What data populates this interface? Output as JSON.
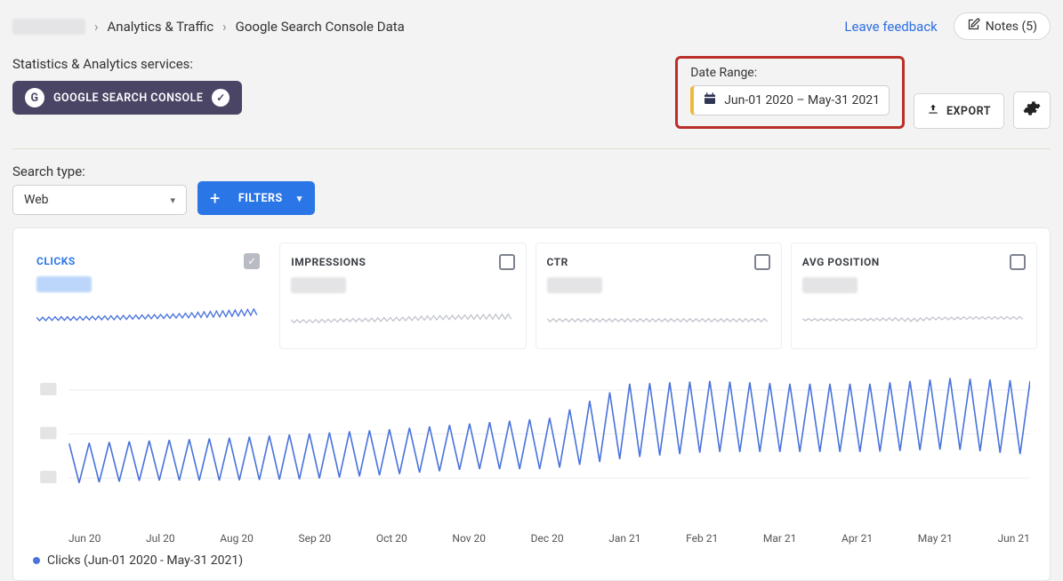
{
  "breadcrumb": {
    "section": "Analytics & Traffic",
    "page": "Google Search Console Data"
  },
  "header": {
    "feedback": "Leave feedback",
    "notes": "Notes (5)"
  },
  "services": {
    "label": "Statistics & Analytics services:",
    "gsc_chip": "GOOGLE SEARCH CONSOLE"
  },
  "date_range": {
    "label": "Date Range:",
    "value": "Jun-01 2020 – May-31 2021"
  },
  "export_label": "EXPORT",
  "search_type": {
    "label": "Search type:",
    "value": "Web"
  },
  "filters_label": "FILTERS",
  "kpis": [
    {
      "title": "CLICKS",
      "checked": true
    },
    {
      "title": "IMPRESSIONS",
      "checked": false
    },
    {
      "title": "CTR",
      "checked": false
    },
    {
      "title": "AVG POSITION",
      "checked": false
    }
  ],
  "legend": "Clicks (Jun-01 2020 - May-31 2021)",
  "chart_data": {
    "type": "line",
    "title": "",
    "xlabel": "",
    "ylabel": "",
    "x_categories": [
      "Jun 20",
      "Jul 20",
      "Aug 20",
      "Sep 20",
      "Oct 20",
      "Nov 20",
      "Dec 20",
      "Jan 21",
      "Feb 21",
      "Mar 21",
      "Apr 21",
      "May 21",
      "Jun 21"
    ],
    "series": [
      {
        "name": "Clicks",
        "color": "#4a74dc",
        "note": "Daily data with weekly seasonality (weekend dips). Values are relative estimates read from an unlabeled y-axis; trend rises ~45→~95 over the year with a step-up around Jan 2021.",
        "monthly_envelope": [
          {
            "month": "Jun 20",
            "low": 20,
            "high": 48
          },
          {
            "month": "Jul 20",
            "low": 22,
            "high": 50
          },
          {
            "month": "Aug 20",
            "low": 22,
            "high": 52
          },
          {
            "month": "Sep 20",
            "low": 23,
            "high": 55
          },
          {
            "month": "Oct 20",
            "low": 26,
            "high": 58
          },
          {
            "month": "Nov 20",
            "low": 30,
            "high": 62
          },
          {
            "month": "Dec 20",
            "low": 30,
            "high": 66
          },
          {
            "month": "Jan 21",
            "low": 38,
            "high": 90
          },
          {
            "month": "Feb 21",
            "low": 42,
            "high": 92
          },
          {
            "month": "Mar 21",
            "low": 42,
            "high": 90
          },
          {
            "month": "Apr 21",
            "low": 42,
            "high": 90
          },
          {
            "month": "May 21",
            "low": 44,
            "high": 94
          },
          {
            "month": "Jun 21",
            "low": 40,
            "high": 92
          }
        ],
        "ylim": [
          0,
          100
        ]
      }
    ],
    "sparklines": {
      "clicks": {
        "color": "#4a74dc",
        "trend_low_high": [
          [
            35,
            28
          ],
          [
            36,
            29
          ],
          [
            36,
            29
          ],
          [
            37,
            30
          ],
          [
            38,
            30
          ],
          [
            39,
            31
          ],
          [
            40,
            32
          ],
          [
            41,
            33
          ],
          [
            43,
            34
          ],
          [
            46,
            35
          ],
          [
            48,
            36
          ],
          [
            50,
            38
          ],
          [
            52,
            40
          ]
        ]
      },
      "impressions": {
        "color": "#c4c7cf",
        "trend_low_high": [
          [
            32,
            26
          ],
          [
            32,
            26
          ],
          [
            33,
            27
          ],
          [
            34,
            28
          ],
          [
            35,
            28
          ],
          [
            36,
            29
          ],
          [
            37,
            30
          ],
          [
            39,
            31
          ],
          [
            40,
            32
          ],
          [
            41,
            33
          ],
          [
            42,
            33
          ],
          [
            43,
            33
          ],
          [
            43,
            33
          ]
        ]
      },
      "ctr": {
        "color": "#c4c7cf",
        "trend_low_high": [
          [
            34,
            28
          ],
          [
            34,
            28
          ],
          [
            34,
            28
          ],
          [
            34,
            28
          ],
          [
            34,
            28
          ],
          [
            34,
            28
          ],
          [
            34,
            28
          ],
          [
            34,
            28
          ],
          [
            34,
            28
          ],
          [
            34,
            28
          ],
          [
            34,
            28
          ],
          [
            34,
            28
          ],
          [
            34,
            28
          ]
        ]
      },
      "avg_position": {
        "color": "#c4c7cf",
        "trend_low_high": [
          [
            34,
            30
          ],
          [
            34,
            30
          ],
          [
            34,
            30
          ],
          [
            34,
            30
          ],
          [
            35,
            30
          ],
          [
            36,
            30
          ],
          [
            35,
            28
          ],
          [
            37,
            32
          ],
          [
            37,
            32
          ],
          [
            38,
            33
          ],
          [
            38,
            33
          ],
          [
            38,
            33
          ],
          [
            38,
            33
          ]
        ]
      }
    }
  }
}
